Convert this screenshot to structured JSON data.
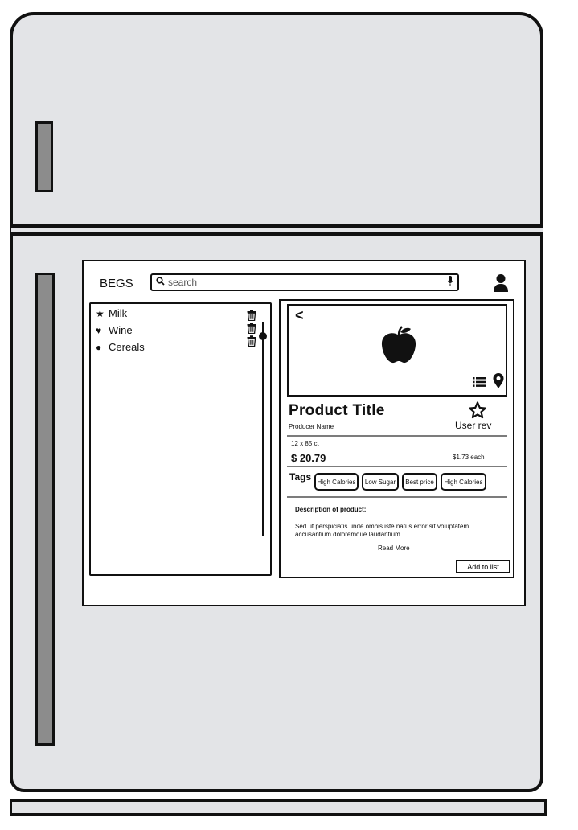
{
  "app": {
    "title": "BEGS"
  },
  "search": {
    "placeholder": "search"
  },
  "shopping_list": {
    "items": [
      {
        "label": "Milk",
        "icon": "star-icon"
      },
      {
        "label": "Wine",
        "icon": "heart-icon"
      },
      {
        "label": "Cereals",
        "icon": "circle-icon"
      }
    ]
  },
  "product": {
    "title": "Product Title",
    "producer": "Producer Name",
    "user_rev": "User rev",
    "quantity": "12 x 85 ct",
    "price": "$ 20.79",
    "unit_price": "$1.73 each",
    "tags_label": "Tags",
    "tags": [
      "High Calories",
      "Low Sugar",
      "Best price",
      "High Calories"
    ],
    "description_title": "Description of product:",
    "description": "Sed ut perspiciatis unde omnis iste natus error sit voluptatem accusantium doloremque laudantium...",
    "read_more": "Read More",
    "add_button": "Add to list",
    "back_glyph": "<"
  },
  "colors": {
    "fridge": "#e3e4e7",
    "handle": "#8c8c8c",
    "outline": "#111111"
  }
}
